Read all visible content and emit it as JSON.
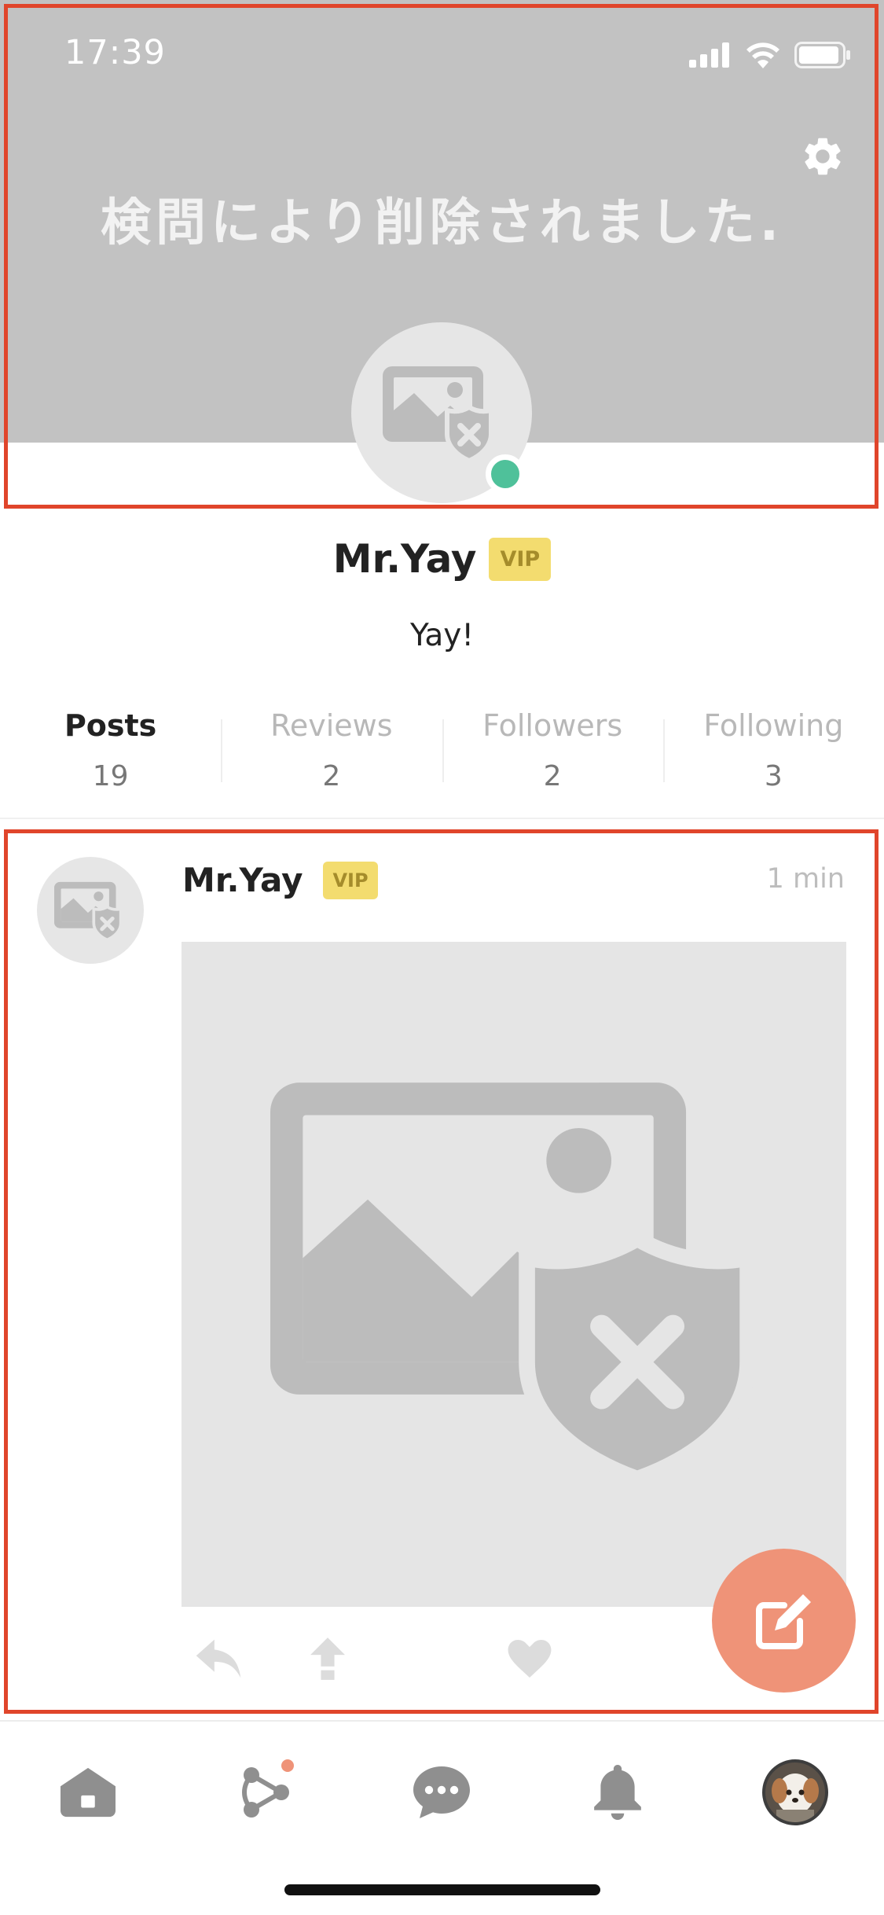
{
  "status_bar": {
    "time": "17:39"
  },
  "banner": {
    "message": "検問により削除されました."
  },
  "profile": {
    "name": "Mr.Yay",
    "badge": "VIP",
    "bio": "Yay!",
    "online": true
  },
  "tabs": [
    {
      "label": "Posts",
      "count": "19",
      "active": true
    },
    {
      "label": "Reviews",
      "count": "2",
      "active": false
    },
    {
      "label": "Followers",
      "count": "2",
      "active": false
    },
    {
      "label": "Following",
      "count": "3",
      "active": false
    }
  ],
  "post": {
    "author": "Mr.Yay",
    "badge": "VIP",
    "time": "1 min"
  },
  "icons": {
    "gear": "gear-icon",
    "censored_image": "censored-image-icon",
    "reply": "reply-icon",
    "share": "share-icon",
    "like": "heart-icon",
    "compose": "compose-icon",
    "home": "home-icon",
    "network": "network-icon",
    "chat": "chat-icon",
    "bell": "bell-icon"
  },
  "colors": {
    "accent": "#ef9378",
    "online": "#4fc19a",
    "vip_bg": "#f3dc6f",
    "vip_text": "#a58c2b",
    "highlight": "#e0452b",
    "banner_bg": "#c2c2c2"
  }
}
